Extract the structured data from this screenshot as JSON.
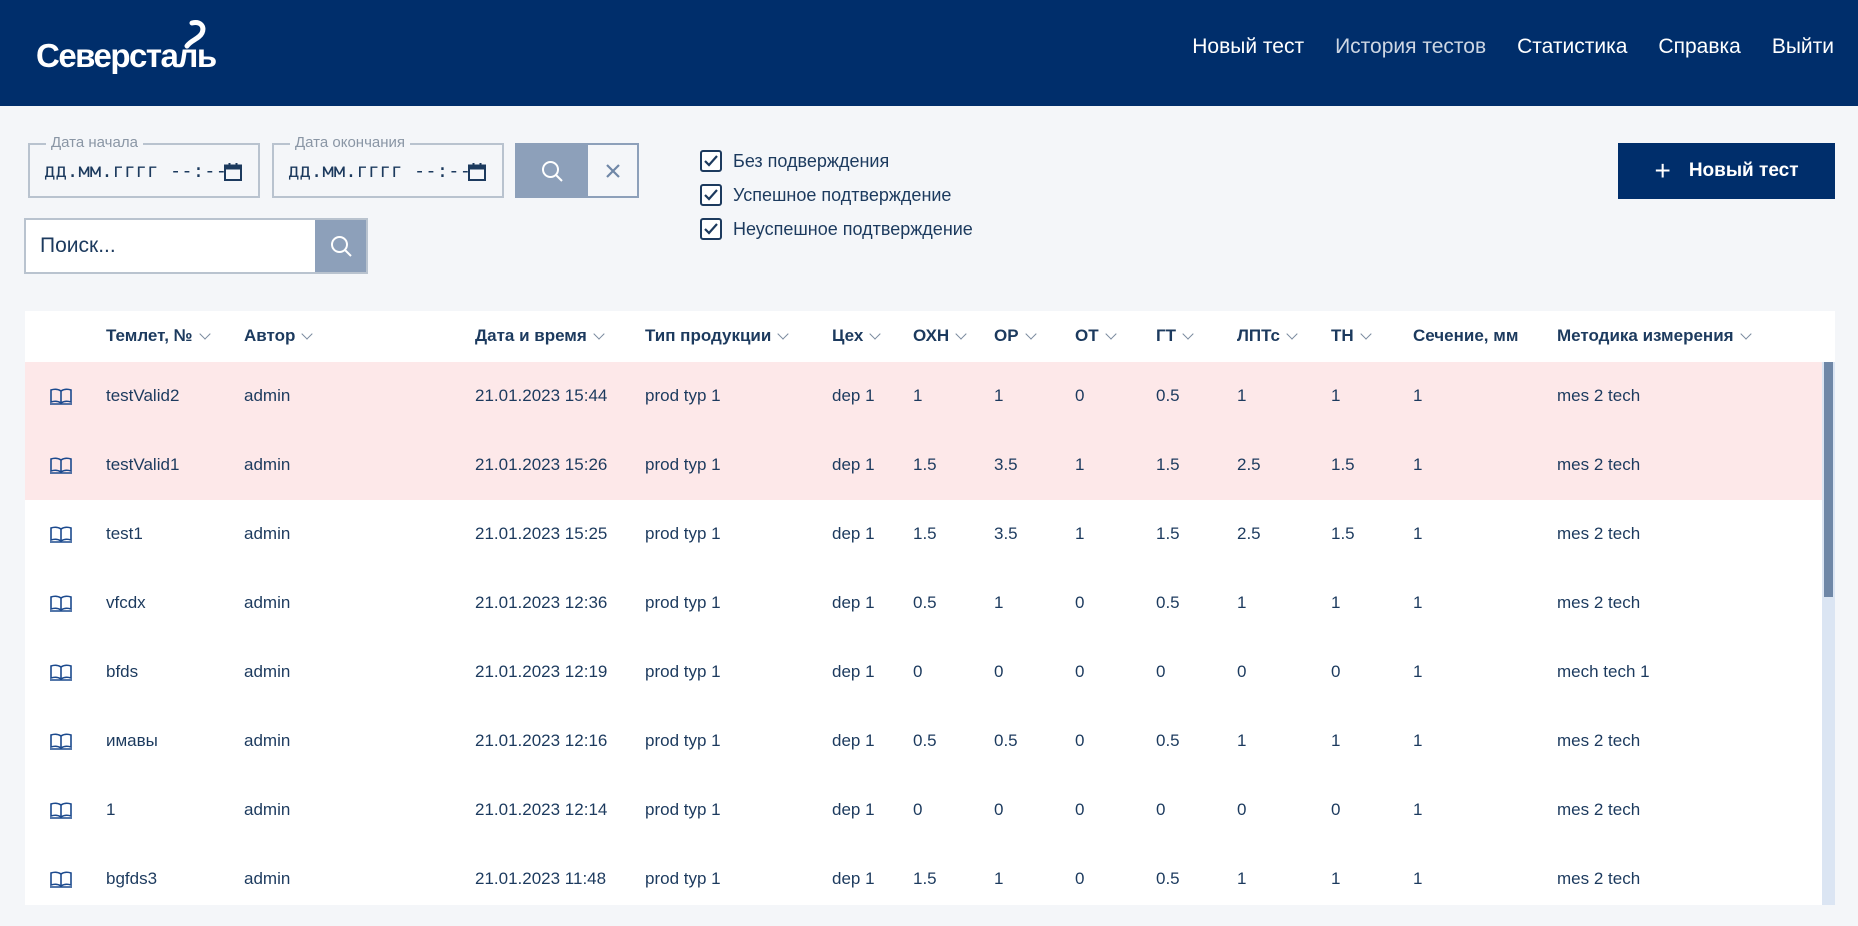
{
  "header": {
    "logo": "Северсталь",
    "nav": [
      "Новый тест",
      "История тестов",
      "Статистика",
      "Справка",
      "Выйти"
    ]
  },
  "filters": {
    "date_start": {
      "label": "Дата начала",
      "value": "дд.мм.гггг --:--"
    },
    "date_end": {
      "label": "Дата окончания",
      "value": "дд.мм.гггг --:--"
    },
    "search_placeholder": "Поиск...",
    "checkboxes": [
      {
        "label": "Без подверждения",
        "checked": true
      },
      {
        "label": "Успешное подтверждение",
        "checked": true
      },
      {
        "label": "Неуспешное подтверждение",
        "checked": true
      }
    ],
    "new_test_label": "Новый тест"
  },
  "table": {
    "columns": [
      "Темлет, №",
      "Автор",
      "Дата и время",
      "Тип продукции",
      "Цех",
      "ОХН",
      "ОР",
      "ОТ",
      "ГТ",
      "ЛПТс",
      "ТН",
      "Сечение, мм",
      "Методика измерения"
    ],
    "rows": [
      {
        "highlight": true,
        "cells": [
          "testValid2",
          "admin",
          "21.01.2023 15:44",
          "prod typ 1",
          "dep 1",
          "1",
          "1",
          "0",
          "0.5",
          "1",
          "1",
          "1",
          "mes 2 tech"
        ]
      },
      {
        "highlight": true,
        "cells": [
          "testValid1",
          "admin",
          "21.01.2023 15:26",
          "prod typ 1",
          "dep 1",
          "1.5",
          "3.5",
          "1",
          "1.5",
          "2.5",
          "1.5",
          "1",
          "mes 2 tech"
        ]
      },
      {
        "highlight": false,
        "cells": [
          "test1",
          "admin",
          "21.01.2023 15:25",
          "prod typ 1",
          "dep 1",
          "1.5",
          "3.5",
          "1",
          "1.5",
          "2.5",
          "1.5",
          "1",
          "mes 2 tech"
        ]
      },
      {
        "highlight": false,
        "cells": [
          "vfcdx",
          "admin",
          "21.01.2023 12:36",
          "prod typ 1",
          "dep 1",
          "0.5",
          "1",
          "0",
          "0.5",
          "1",
          "1",
          "1",
          "mes 2 tech"
        ]
      },
      {
        "highlight": false,
        "cells": [
          "bfds",
          "admin",
          "21.01.2023 12:19",
          "prod typ 1",
          "dep 1",
          "0",
          "0",
          "0",
          "0",
          "0",
          "0",
          "1",
          "mech tech 1"
        ]
      },
      {
        "highlight": false,
        "cells": [
          "имавы",
          "admin",
          "21.01.2023 12:16",
          "prod typ 1",
          "dep 1",
          "0.5",
          "0.5",
          "0",
          "0.5",
          "1",
          "1",
          "1",
          "mes 2 tech"
        ]
      },
      {
        "highlight": false,
        "cells": [
          "1",
          "admin",
          "21.01.2023 12:14",
          "prod typ 1",
          "dep 1",
          "0",
          "0",
          "0",
          "0",
          "0",
          "0",
          "1",
          "mes 2 tech"
        ]
      },
      {
        "highlight": false,
        "cells": [
          "bgfds3",
          "admin",
          "21.01.2023 11:48",
          "prod typ 1",
          "dep 1",
          "1.5",
          "1",
          "0",
          "0.5",
          "1",
          "1",
          "1",
          "mes 2 tech"
        ]
      }
    ]
  },
  "icons": {
    "row_action": "book-icon",
    "calendar": "calendar-icon",
    "search": "search-icon",
    "clear": "close-icon",
    "sort": "chevron-down-icon"
  },
  "colors": {
    "header_bg": "#002e6b",
    "highlight_row": "#fde8e9",
    "button_muted": "#8da0ba",
    "text": "#1c3a5e"
  }
}
